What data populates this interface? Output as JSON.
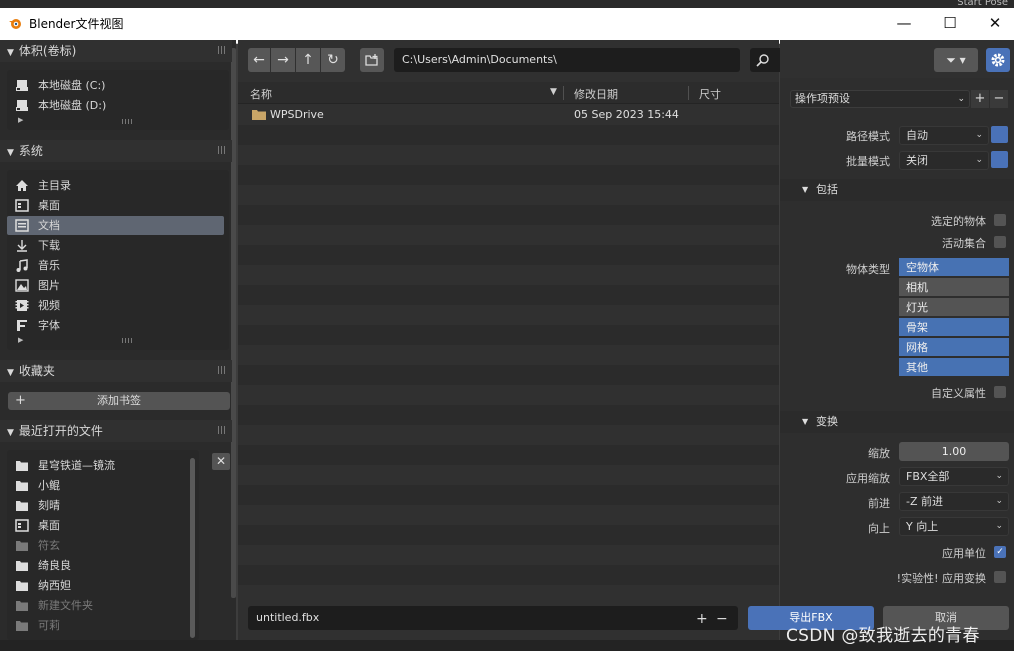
{
  "window": {
    "title": "Blender文件视图",
    "behind_text": "Start Pose",
    "minimize": "—",
    "maximize": "☐",
    "close": "✕"
  },
  "sidebar": {
    "volumes": {
      "header": "体积(卷标)",
      "items": [
        {
          "label": "本地磁盘 (C:)",
          "icon": "drive-icon"
        },
        {
          "label": "本地磁盘 (D:)",
          "icon": "drive-icon"
        }
      ]
    },
    "system": {
      "header": "系统",
      "items": [
        {
          "label": "主目录",
          "icon": "home-icon"
        },
        {
          "label": "桌面",
          "icon": "desktop-icon"
        },
        {
          "label": "文档",
          "icon": "document-icon",
          "selected": true
        },
        {
          "label": "下载",
          "icon": "download-icon"
        },
        {
          "label": "音乐",
          "icon": "music-icon"
        },
        {
          "label": "图片",
          "icon": "image-icon"
        },
        {
          "label": "视频",
          "icon": "video-icon"
        },
        {
          "label": "字体",
          "icon": "font-icon"
        }
      ]
    },
    "bookmarks": {
      "header": "收藏夹",
      "add_label": "添加书签"
    },
    "recent": {
      "header": "最近打开的文件",
      "items": [
        {
          "label": "星穹铁道—镜流",
          "dim": false
        },
        {
          "label": "小鲲",
          "dim": false
        },
        {
          "label": "刻晴",
          "dim": false
        },
        {
          "label": "桌面",
          "dim": false
        },
        {
          "label": "符玄",
          "dim": true
        },
        {
          "label": "绮良良",
          "dim": false
        },
        {
          "label": "纳西妲",
          "dim": false
        },
        {
          "label": "新建文件夹",
          "dim": true
        },
        {
          "label": "可莉",
          "dim": true
        }
      ]
    }
  },
  "browser": {
    "path": "C:\\Users\\Admin\\Documents\\",
    "columns": {
      "name": "名称",
      "date": "修改日期",
      "size": "尺寸"
    },
    "files": [
      {
        "name": "WPSDrive",
        "date": "05 Sep 2023 15:44",
        "type": "folder"
      }
    ],
    "filename": "untitled.fbx"
  },
  "options": {
    "preset_label": "操作项预设",
    "path_mode": {
      "label": "路径模式",
      "value": "自动"
    },
    "batch_mode": {
      "label": "批量模式",
      "value": "关闭"
    },
    "include": {
      "header": "包括",
      "selected_objects": {
        "label": "选定的物体",
        "checked": false
      },
      "active_collection": {
        "label": "活动集合",
        "checked": false
      },
      "object_types_label": "物体类型",
      "object_types": [
        {
          "label": "空物体",
          "on": true
        },
        {
          "label": "相机",
          "on": false
        },
        {
          "label": "灯光",
          "on": false
        },
        {
          "label": "骨架",
          "on": true
        },
        {
          "label": "网格",
          "on": true
        },
        {
          "label": "其他",
          "on": true
        }
      ],
      "custom_props": {
        "label": "自定义属性",
        "checked": false
      }
    },
    "transform": {
      "header": "变换",
      "scale": {
        "label": "缩放",
        "value": "1.00"
      },
      "apply_scaling": {
        "label": "应用缩放",
        "value": "FBX全部"
      },
      "forward": {
        "label": "前进",
        "value": "-Z 前进"
      },
      "up": {
        "label": "向上",
        "value": "Y 向上"
      },
      "apply_unit": {
        "label": "应用单位",
        "checked": true
      },
      "apply_transform": {
        "label": "!实验性! 应用变换",
        "checked": false
      }
    }
  },
  "actions": {
    "export": "导出FBX",
    "cancel": "取消"
  },
  "watermark": "CSDN @致我逝去的青春",
  "colors": {
    "accent": "#4a72b8",
    "selected": "#5f6672"
  }
}
